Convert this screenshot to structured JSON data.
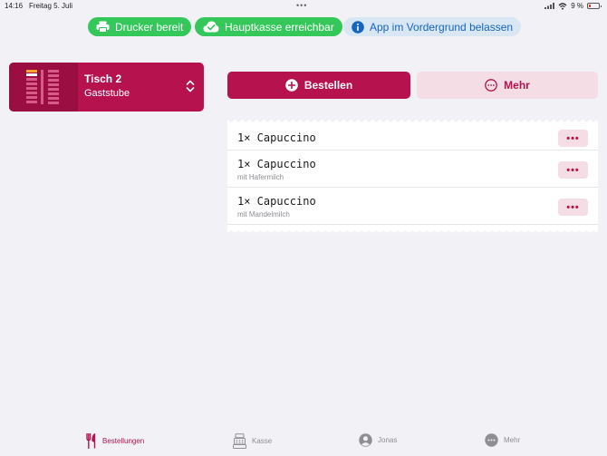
{
  "statusbar": {
    "time": "14:16",
    "date": "Freitag 5. Juli",
    "battery": "9 %"
  },
  "pills": {
    "printer": "Drucker bereit",
    "register": "Hauptkasse erreichbar",
    "foreground": "App im Vordergrund belassen"
  },
  "table": {
    "name": "Tisch 2",
    "area": "Gaststube"
  },
  "actions": {
    "order": "Bestellen",
    "more": "Mehr"
  },
  "orders": [
    {
      "item": "1× Capuccino",
      "modifier": ""
    },
    {
      "item": "1× Capuccino",
      "modifier": "mit Hafermilch"
    },
    {
      "item": "1× Capuccino",
      "modifier": "mit Mandelmilch"
    }
  ],
  "row_menu": "•••",
  "tabs": {
    "orders": "Bestellungen",
    "register": "Kasse",
    "user": "Jonas",
    "more": "Mehr"
  },
  "colors": {
    "accent": "#b5124e",
    "accent_soft": "#f4dde5",
    "success": "#34c759",
    "info_bg": "#d9e6f4",
    "info_text": "#1565c0"
  }
}
